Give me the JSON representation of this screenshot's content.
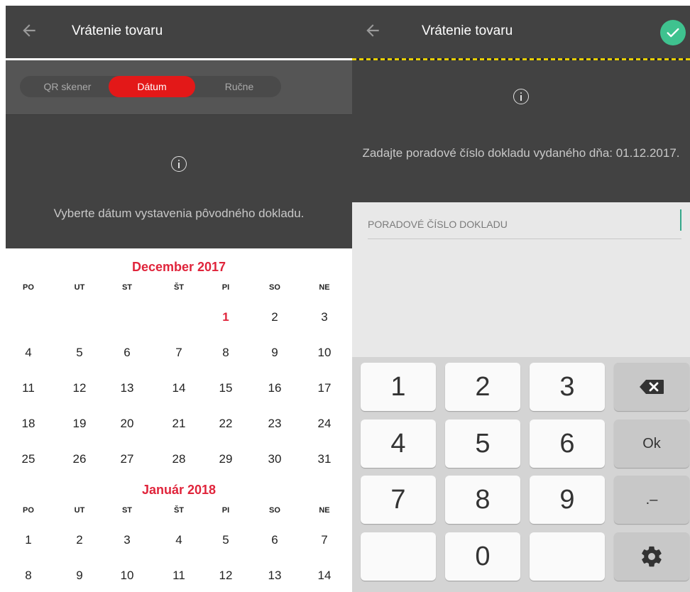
{
  "left": {
    "title": "Vrátenie tovaru",
    "tabs": [
      "QR skener",
      "Dátum",
      "Ručne"
    ],
    "info_text": "Vyberte dátum vystavenia pôvodného dokladu.",
    "weekdays": [
      "PO",
      "UT",
      "ST",
      "ŠT",
      "PI",
      "SO",
      "NE"
    ],
    "months": [
      {
        "title": "December 2017",
        "weeks": [
          [
            "",
            "",
            "",
            "",
            "1",
            "2",
            "3"
          ],
          [
            "4",
            "5",
            "6",
            "7",
            "8",
            "9",
            "10"
          ],
          [
            "11",
            "12",
            "13",
            "14",
            "15",
            "16",
            "17"
          ],
          [
            "18",
            "19",
            "20",
            "21",
            "22",
            "23",
            "24"
          ],
          [
            "25",
            "26",
            "27",
            "28",
            "29",
            "30",
            "31"
          ]
        ],
        "selected_day": "1"
      },
      {
        "title": "Január 2018",
        "weeks": [
          [
            "1",
            "2",
            "3",
            "4",
            "5",
            "6",
            "7"
          ],
          [
            "8",
            "9",
            "10",
            "11",
            "12",
            "13",
            "14"
          ]
        ],
        "selected_day": ""
      }
    ]
  },
  "right": {
    "title": "Vrátenie tovaru",
    "info_text": "Zadajte poradové číslo dokladu vydaného dňa: 01.12.2017.",
    "field_label": "PORADOVÉ ČÍSLO DOKLADU",
    "keys": [
      [
        "1",
        "2",
        "3",
        "backspace-icon"
      ],
      [
        "4",
        "5",
        "6",
        "Ok"
      ],
      [
        "7",
        "8",
        "9",
        ".–"
      ],
      [
        "",
        "0",
        "",
        "gear-icon"
      ]
    ]
  },
  "colors": {
    "accent_red": "#e0243b",
    "segment_active": "#e31818",
    "confirm_green": "#3fc28f",
    "appbar": "#424242"
  }
}
